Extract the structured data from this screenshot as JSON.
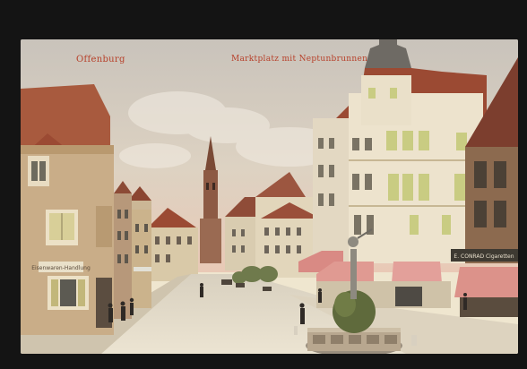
{
  "postcard": {
    "city": "Offenburg",
    "title": "Marktplatz mit Neptunbrunnen",
    "shop_sign": "E. CONRAD Cigaretten",
    "wall_sign": "Eisenwaren-Handlung"
  },
  "colors": {
    "frame": "#141414",
    "paper": "#efe6cf",
    "caption_red": "#b7402a",
    "sky": "#d8cfc0",
    "roof_red": "#9b4a33",
    "facade_cream": "#e8dcc2",
    "awning_pink": "#d98a84"
  }
}
